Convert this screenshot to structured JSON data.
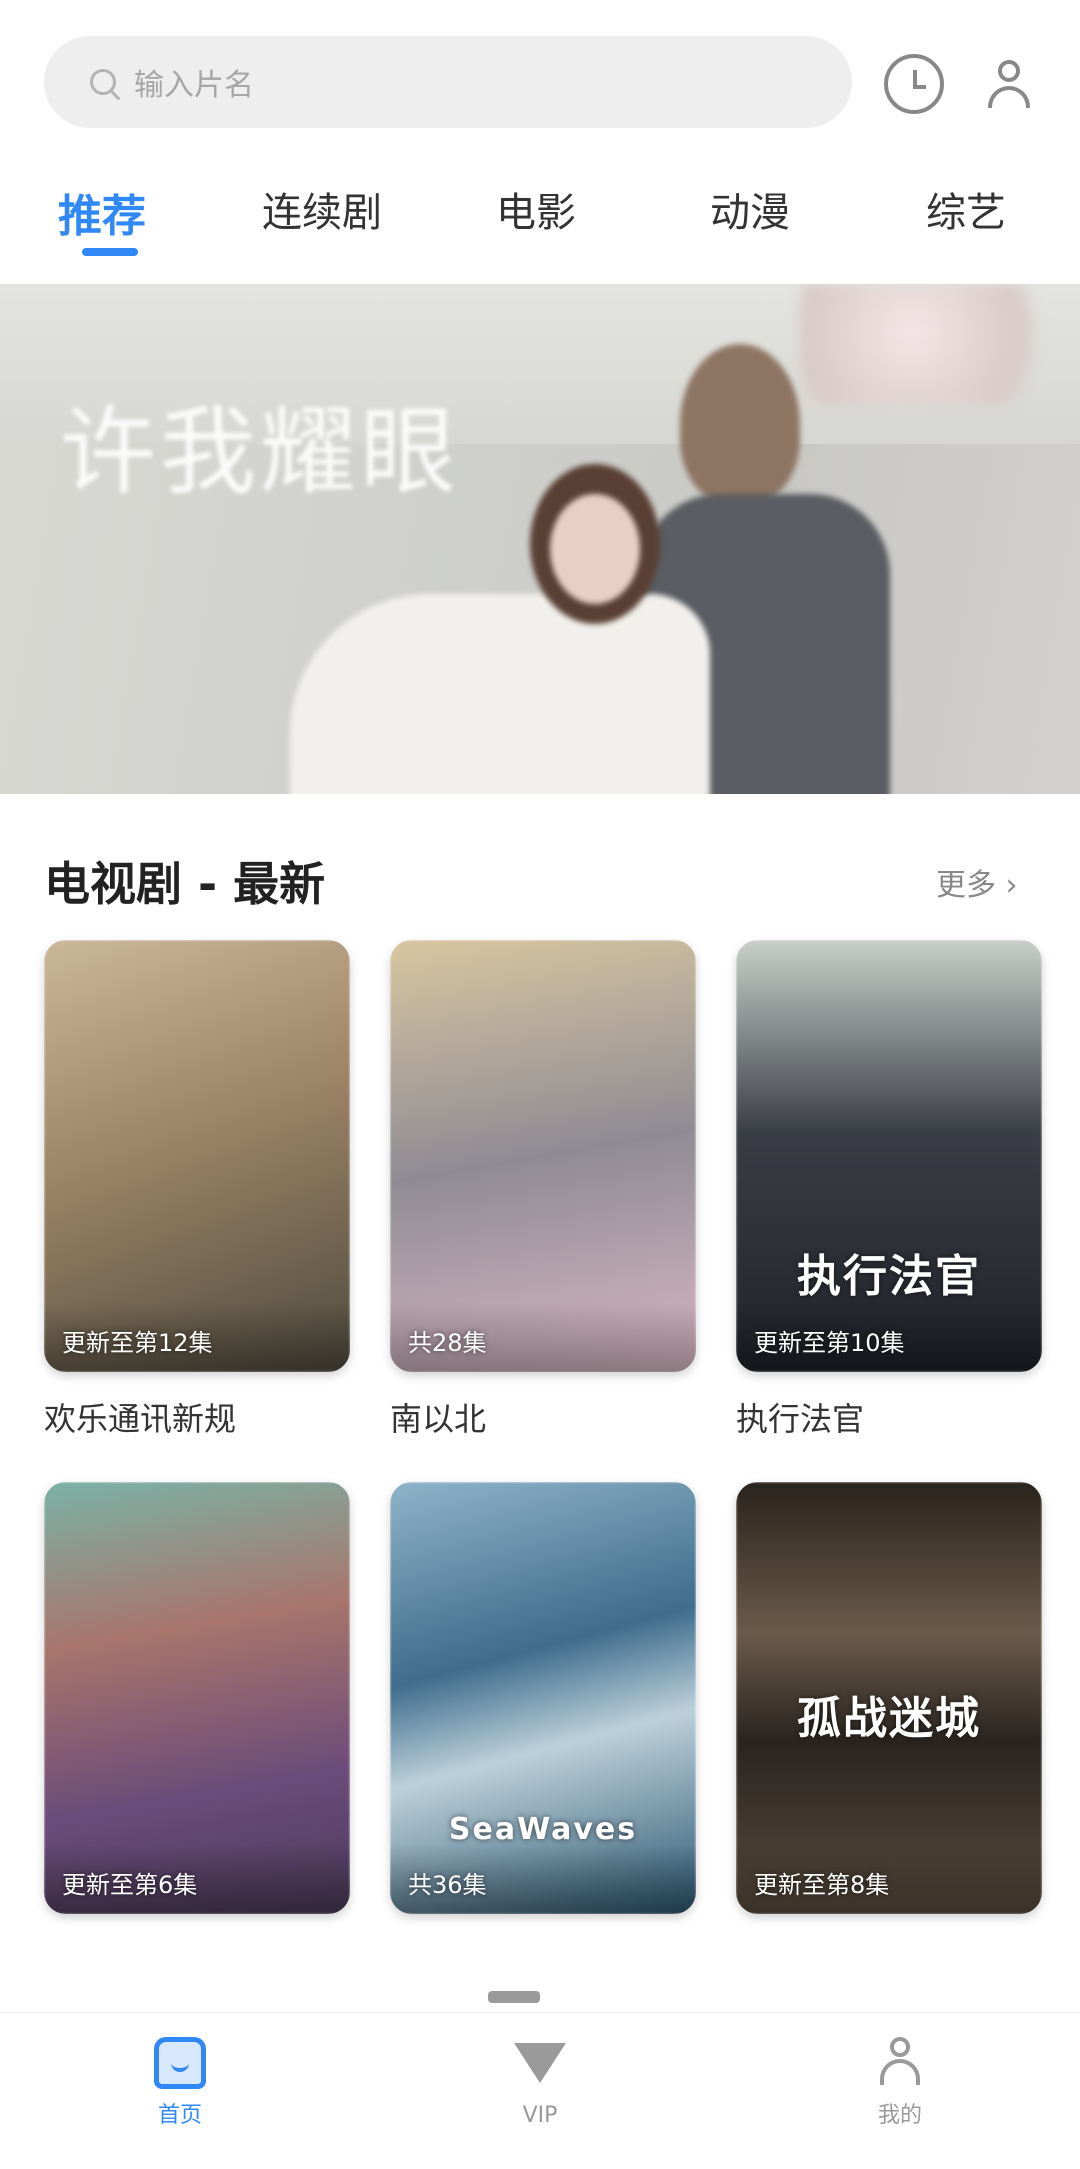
{
  "search": {
    "placeholder": "输入片名"
  },
  "header": {
    "history_icon": "history-icon",
    "user_icon": "user-icon"
  },
  "tabs": [
    {
      "label": "推荐",
      "active": true
    },
    {
      "label": "连续剧",
      "active": false
    },
    {
      "label": "电影",
      "active": false
    },
    {
      "label": "动漫",
      "active": false
    },
    {
      "label": "综艺",
      "active": false
    }
  ],
  "banner": {
    "calligraphy": "许我耀眼"
  },
  "section": {
    "title": "电视剧 - 最新",
    "more": "更多 ›"
  },
  "cards": [
    {
      "title": "欢乐通讯新规",
      "badge": "更新至第12集",
      "poster_text": ""
    },
    {
      "title": "南以北",
      "badge": "共28集",
      "poster_text": ""
    },
    {
      "title": "执行法官",
      "badge": "更新至第10集",
      "poster_text": "执行法官"
    },
    {
      "title": "",
      "badge": "更新至第6集",
      "poster_text": ""
    },
    {
      "title": "",
      "badge": "共36集",
      "poster_text": "SeaWaves"
    },
    {
      "title": "",
      "badge": "更新至第8集",
      "poster_text": "孤战迷城"
    }
  ],
  "bottom_nav": [
    {
      "label": "首页",
      "icon": "home-icon",
      "active": true
    },
    {
      "label": "VIP",
      "icon": "vip-diamond-icon",
      "active": false
    },
    {
      "label": "我的",
      "icon": "profile-icon",
      "active": false
    }
  ],
  "colors": {
    "accent": "#2f88f5",
    "search_bg": "#eeeeee",
    "text_primary": "#222222",
    "text_muted": "#999999"
  }
}
